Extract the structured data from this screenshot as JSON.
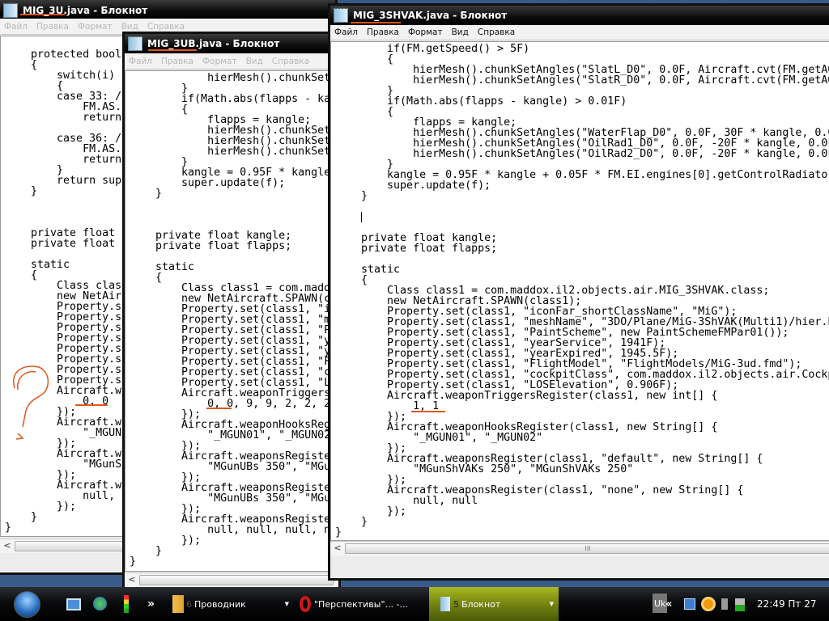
{
  "windows": [
    {
      "title": "MIG_3U.java - Блокнот",
      "menu": [
        "Файл",
        "Правка",
        "Формат",
        "Вид",
        "Справка"
      ],
      "lines": [
        "    protected boole",
        "    {",
        "        switch(i)",
        "        {",
        "        case 33: //",
        "            FM.AS.h",
        "            return ",
        "",
        "        case 36: //",
        "            FM.AS.h",
        "            return ",
        "        }",
        "        return supe",
        "    }",
        "",
        "",
        "",
        "    private float k",
        "    private float f",
        "",
        "    static",
        "    {",
        "        Class class",
        "        new NetAirc",
        "        Property.se",
        "        Property.se",
        "        Property.se",
        "        Property.se",
        "        Property.se",
        "        Property.se",
        "        Property.se",
        "        Property.se",
        "        Aircraft.we",
        "            0, 0",
        "        });",
        "        Aircraft.we",
        "            \"_MGUN0",
        "        });",
        "        Aircraft.we",
        "            \"MGunSh",
        "        });",
        "        Aircraft.we",
        "            null, n",
        "        });",
        "    }",
        "}"
      ]
    },
    {
      "title": "MIG_3UB.java - Блокнот",
      "menu": [
        "Файл",
        "Правка",
        "Формат",
        "Вид",
        "Справка"
      ],
      "lines": [
        "            hierMesh().chunkSet",
        "        }",
        "        if(Math.abs(flapps - ka",
        "        {",
        "            flapps = kangle;",
        "            hierMesh().chunkSet",
        "            hierMesh().chunkSet",
        "            hierMesh().chunkSet",
        "        }",
        "        kangle = 0.95F * kangle",
        "        super.update(f);",
        "    }",
        "",
        "",
        "",
        "    private float kangle;",
        "    private float flapps;",
        "",
        "    static",
        "    {",
        "        Class class1 = com.madd",
        "        new NetAircraft.SPAWN(c",
        "        Property.set(class1, \"i",
        "        Property.set(class1, \"m",
        "        Property.set(class1, \"P",
        "        Property.set(class1, \"y",
        "        Property.set(class1, \"y",
        "        Property.set(class1, \"F",
        "        Property.set(class1, \"c",
        "        Property.set(class1, \"L",
        "        Aircraft.weaponTriggers",
        "            0, 0, 9, 9, 2, 2, 2",
        "        });",
        "        Aircraft.weaponHooksReg",
        "            \"_MGUN01\", \"_MGUN02",
        "        });",
        "        Aircraft.weaponsRegiste",
        "            \"MGunUBs 350\", \"MGu",
        "        });",
        "        Aircraft.weaponsRegiste",
        "            \"MGunUBs 350\", \"MGu",
        "        });",
        "        Aircraft.weaponsRegiste",
        "            null, null, null, n",
        "        });",
        "    }",
        "}"
      ]
    },
    {
      "title": "MIG_3SHVAK.java - Блокнот",
      "menu": [
        "Файл",
        "Правка",
        "Формат",
        "Вид",
        "Справка"
      ],
      "lines": [
        "        if(FM.getSpeed() > 5F)",
        "        {",
        "            hierMesh().chunkSetAngles(\"SlatL_D0\", 0.0F, Aircraft.cvt(FM.getAO",
        "            hierMesh().chunkSetAngles(\"SlatR_D0\", 0.0F, Aircraft.cvt(FM.getAO",
        "        }",
        "        if(Math.abs(flapps - kangle) > 0.01F)",
        "        {",
        "            flapps = kangle;",
        "            hierMesh().chunkSetAngles(\"WaterFlap_D0\", 0.0F, 30F * kangle, 0.0",
        "            hierMesh().chunkSetAngles(\"OilRad1_D0\", 0.0F, -20F * kangle, 0.0F",
        "            hierMesh().chunkSetAngles(\"OilRad2_D0\", 0.0F, -20F * kangle, 0.0F",
        "        }",
        "        kangle = 0.95F * kangle + 0.05F * FM.EI.engines[0].getControlRadiator",
        "        super.update(f);",
        "    }",
        "",
        "",
        "",
        "    private float kangle;",
        "    private float flapps;",
        "",
        "    static",
        "    {",
        "        Class class1 = com.maddox.il2.objects.air.MIG_3SHVAK.class;",
        "        new NetAircraft.SPAWN(class1);",
        "        Property.set(class1, \"iconFar_shortClassName\", \"MiG\");",
        "        Property.set(class1, \"meshName\", \"3DO/Plane/MiG-3ShVAK(Multi1)/hier.h",
        "        Property.set(class1, \"PaintScheme\", new PaintSchemeFMPar01());",
        "        Property.set(class1, \"yearService\", 1941F);",
        "        Property.set(class1, \"yearExpired\", 1945.5F);",
        "        Property.set(class1, \"FlightModel\", \"FlightModels/MiG-3ud.fmd\");",
        "        Property.set(class1, \"cockpitClass\", com.maddox.il2.objects.air.Cockp",
        "        Property.set(class1, \"LOSElevation\", 0.906F);",
        "        Aircraft.weaponTriggersRegister(class1, new int[] {",
        "            1, 1",
        "        });",
        "        Aircraft.weaponHooksRegister(class1, new String[] {",
        "            \"_MGUN01\", \"_MGUN02\"",
        "        });",
        "        Aircraft.weaponsRegister(class1, \"default\", new String[] {",
        "            \"MGunShVAKs 250\", \"MGunShVAKs 250\"",
        "        });",
        "        Aircraft.weaponsRegister(class1, \"none\", new String[] {",
        "            null, null",
        "        });",
        "    }",
        "}"
      ]
    }
  ],
  "annotation": {
    "question_mark": "?"
  },
  "taskbar": {
    "explorer": {
      "count": "6",
      "label": "Проводник"
    },
    "opera": {
      "label": "\"Перспективы\"... -..."
    },
    "notepad": {
      "count": "5",
      "label": "Блокнот"
    },
    "overflow": "»",
    "tray_lang": "Uk",
    "tray_expand": "«",
    "clock": "22:49 Пт 27"
  },
  "colors": {
    "annotation": "#e0561c",
    "active_task": "#7d8f12"
  }
}
